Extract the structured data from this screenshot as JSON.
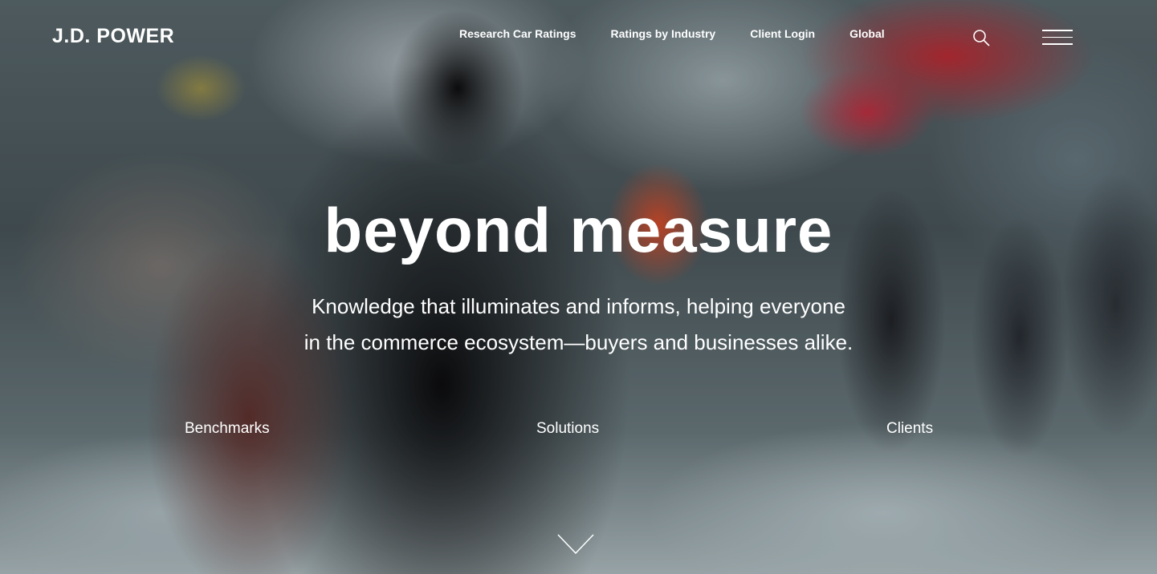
{
  "header": {
    "logo": "J.D. POWER",
    "nav": [
      {
        "label": "Research Car Ratings"
      },
      {
        "label": "Ratings by Industry"
      },
      {
        "label": "Client Login"
      },
      {
        "label": "Global"
      }
    ],
    "search_icon": "search-icon",
    "menu_icon": "hamburger-menu-icon"
  },
  "hero": {
    "headline": "beyond measure",
    "subtitle_line1": "Knowledge that illuminates and informs, helping everyone",
    "subtitle_line2": "in the commerce ecosystem—buyers and businesses alike."
  },
  "sections": [
    {
      "label": "Benchmarks"
    },
    {
      "label": "Solutions"
    },
    {
      "label": "Clients"
    }
  ],
  "scroll_icon": "chevron-down-icon",
  "colors": {
    "text": "#ffffff"
  }
}
